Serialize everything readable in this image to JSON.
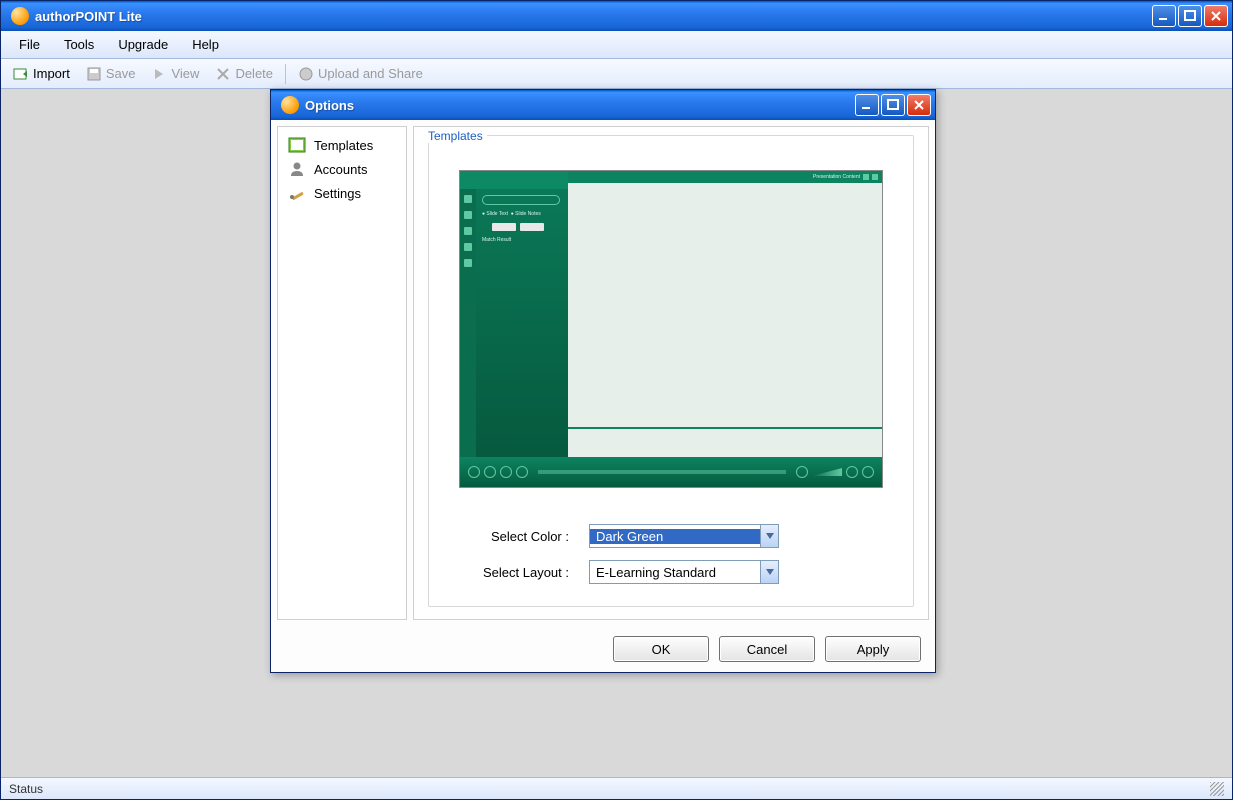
{
  "app": {
    "title": "authorPOINT Lite"
  },
  "menubar": {
    "items": [
      "File",
      "Tools",
      "Upgrade",
      "Help"
    ]
  },
  "toolbar": {
    "import": "Import",
    "save": "Save",
    "view": "View",
    "delete": "Delete",
    "upload": "Upload and Share"
  },
  "statusbar": {
    "text": "Status"
  },
  "dialog": {
    "title": "Options",
    "sidebar": {
      "items": [
        {
          "label": "Templates"
        },
        {
          "label": "Accounts"
        },
        {
          "label": "Settings"
        }
      ]
    },
    "section_title": "Templates",
    "color_label": "Select Color :",
    "color_value": "Dark Green",
    "layout_label": "Select Layout :",
    "layout_value": "E-Learning Standard",
    "buttons": {
      "ok": "OK",
      "cancel": "Cancel",
      "apply": "Apply"
    }
  }
}
